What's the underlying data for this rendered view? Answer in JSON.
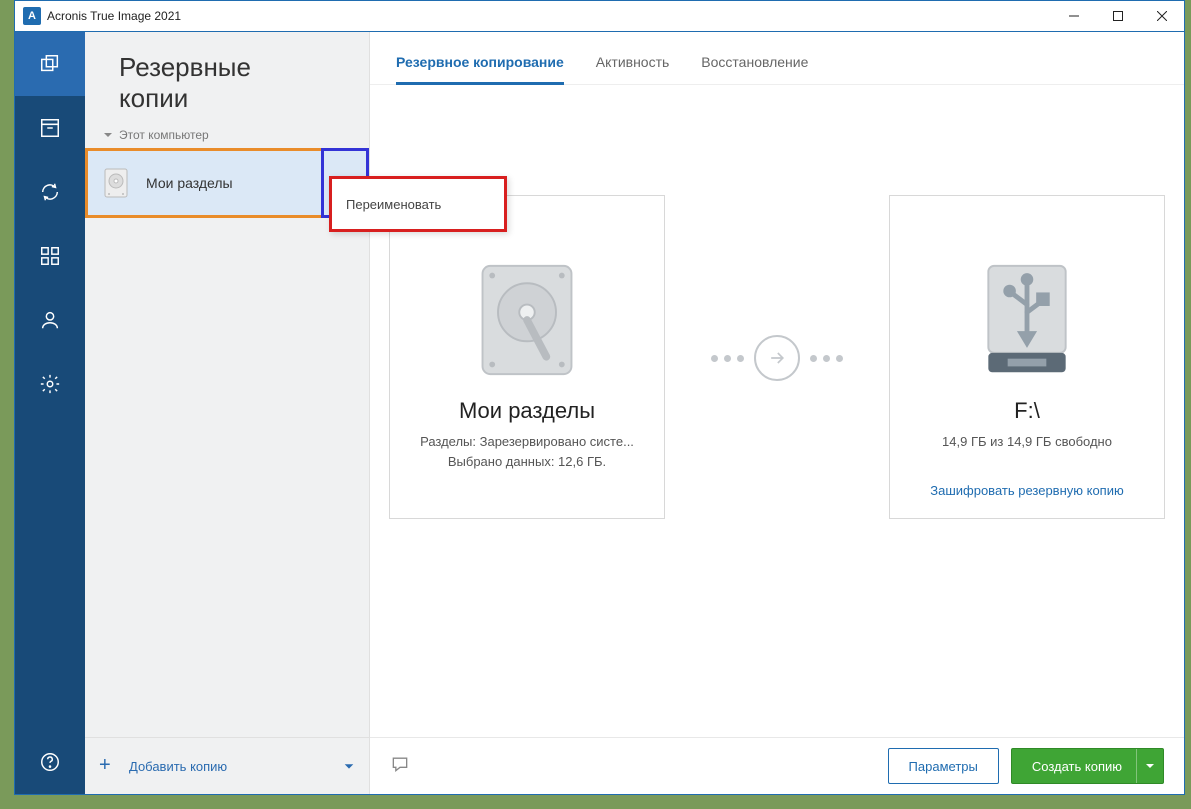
{
  "window": {
    "title": "Acronis True Image 2021",
    "app_letter": "A"
  },
  "sidebar": {
    "heading_line1": "Резервные",
    "heading_line2": "копии",
    "group": "Этот компьютер",
    "backup_item": {
      "label": "Мои разделы"
    },
    "context_menu": {
      "rename": "Переименовать"
    },
    "add_backup": "Добавить копию"
  },
  "tabs": {
    "t0": "Резервное копирование",
    "t1": "Активность",
    "t2": "Восстановление"
  },
  "source": {
    "title": "Мои разделы",
    "line1": "Разделы: Зарезервировано систе...",
    "line2": "Выбрано данных: 12,6 ГБ."
  },
  "dest": {
    "title": "F:\\",
    "line1": "14,9 ГБ из 14,9 ГБ свободно",
    "encrypt": "Зашифровать резервную копию"
  },
  "footer": {
    "params": "Параметры",
    "create": "Создать копию"
  }
}
